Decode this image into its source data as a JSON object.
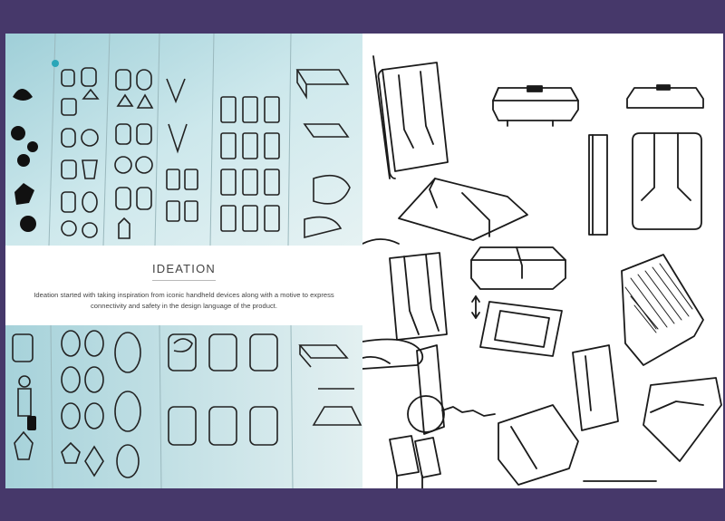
{
  "caption": {
    "title": "IDEATION",
    "body": "Ideation started with taking inspiration from iconic handheld devices along with a motive to express connectivity and safety in the design language of the product."
  },
  "colors": {
    "frame": "#46386a",
    "photo_tint": "#bfe0e6",
    "ink": "#1a1a1a"
  },
  "photos": {
    "top": "sketch-wall-photo-top",
    "bottom": "sketch-wall-photo-bottom"
  }
}
